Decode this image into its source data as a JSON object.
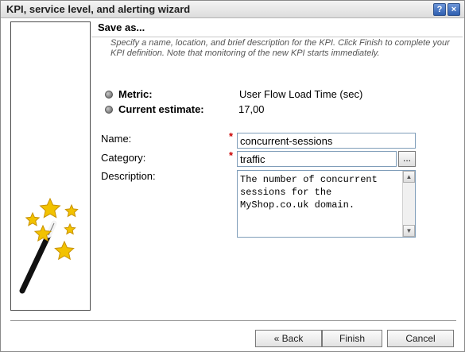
{
  "window": {
    "title": "KPI, service level, and alerting wizard",
    "help_button": "?",
    "close_button": "×"
  },
  "side_panel": {
    "icon": "magic-wand-stars-icon"
  },
  "header": {
    "title": "Save as...",
    "instructions": "Specify a name, location, and brief description for the KPI. Click Finish to complete your KPI definition. Note that monitoring of the new KPI starts immediately."
  },
  "kpi_info": {
    "metric_label": "Metric:",
    "metric_value": "User Flow Load Time (sec)",
    "estimate_label": "Current estimate:",
    "estimate_value": "17,00"
  },
  "form": {
    "name_label": "Name:",
    "name_value": "concurrent-sessions",
    "category_label": "Category:",
    "category_value": "traffic",
    "browse_label": "...",
    "description_label": "Description:",
    "description_value": "The number of concurrent\nsessions for the\nMyShop.co.uk domain.",
    "required_marker": "*"
  },
  "buttons": {
    "back": "« Back",
    "finish": "Finish",
    "cancel": "Cancel"
  },
  "colors": {
    "required": "#cc0000",
    "star": "#f2c200",
    "title_button": "#2f5fb0"
  }
}
